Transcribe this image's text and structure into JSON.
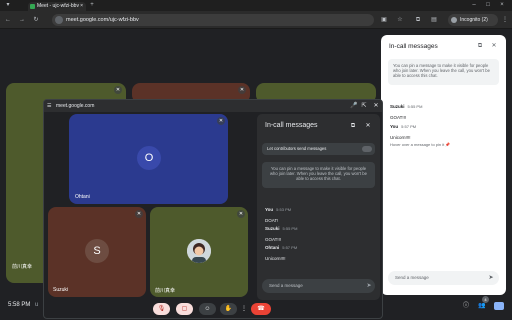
{
  "browser": {
    "tab_title": "Meet - ujc-wfzi-bbv",
    "url": "meet.google.com/ujc-wfzi-bbv",
    "incognito_label": "Incognito (2)"
  },
  "meet": {
    "time": "5:58 PM",
    "time_suffix": "u",
    "people_count": "4",
    "left_tile_name": "前川真幸"
  },
  "right_panel": {
    "title": "In-call messages",
    "info": "You can pin a message to make it visible for people who join later. When you leave the call, you won't be able to access this chat.",
    "messages": [
      {
        "name": "Suzuki",
        "time": "5:55 PM",
        "text": "GOAT!!!"
      },
      {
        "name": "You",
        "time": "5:57 PM",
        "text": "Unicorn!!!!"
      }
    ],
    "hover_hint": "Hover over a message to pin it",
    "input_placeholder": "Send a message"
  },
  "pip": {
    "host": "meet.google.com",
    "tiles": {
      "ohtani": {
        "initial": "O",
        "name": "Ohtani",
        "color": "#2b3a8f"
      },
      "suzuki": {
        "initial": "S",
        "name": "Suzuki",
        "color": "#5b3227"
      },
      "maekawa": {
        "name": "前川真幸",
        "color": "#4e5a2c"
      }
    },
    "chat": {
      "title": "In-call messages",
      "toggle_label": "Let contributors send messages",
      "info": "You can pin a message to make it visible for people who join later. When you leave the call, you won't be able to access this chat.",
      "messages": [
        {
          "name": "You",
          "time": "5:53 PM",
          "text": "DOAT!"
        },
        {
          "name": "Suzuki",
          "time": "5:55 PM",
          "text": "GOAT!!!"
        },
        {
          "name": "Ohtani",
          "time": "5:57 PM",
          "text": "Unicorn!!!!"
        }
      ],
      "input_placeholder": "Send a message"
    }
  }
}
